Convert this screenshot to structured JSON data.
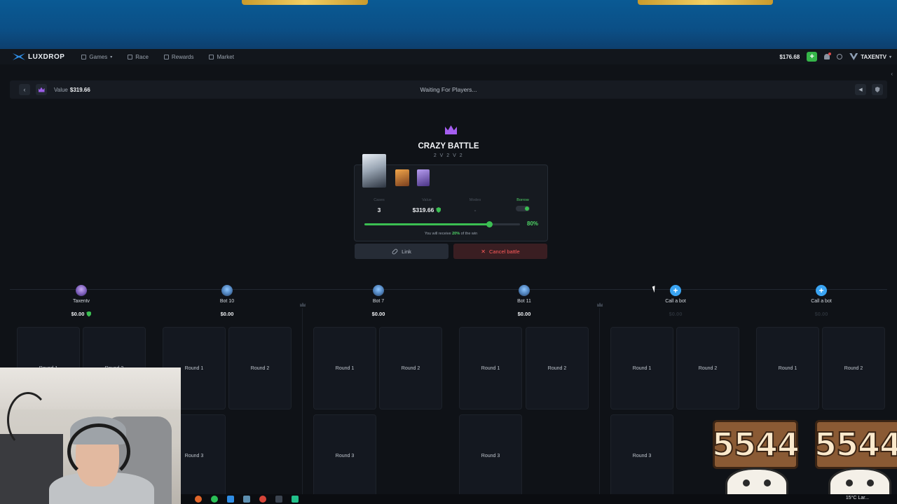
{
  "nav": {
    "brand": "LUXDROP",
    "items": [
      {
        "label": "Games",
        "icon": "gamepad-icon"
      },
      {
        "label": "Race",
        "icon": "flag-icon"
      },
      {
        "label": "Rewards",
        "icon": "gift-icon"
      },
      {
        "label": "Market",
        "icon": "cart-icon"
      }
    ],
    "balance": "$176.68",
    "add_funds": "+",
    "username": "TAXENTV"
  },
  "battle_bar": {
    "value_label": "Value",
    "value": "$319.66",
    "status": "Waiting For Players..."
  },
  "battle": {
    "title": "CRAZY BATTLE",
    "mode": "2 V 2 V 2",
    "stats": {
      "cases_label": "Cases",
      "cases": "3",
      "value_label": "Value",
      "value": "$319.66",
      "modes_label": "Modes",
      "modes": "-",
      "borrow_label": "Borrow"
    },
    "borrow_percent": 80,
    "borrow_percent_text": "80%",
    "receive_prefix": "You will receive",
    "receive_percent": "20%",
    "receive_suffix": "of the win",
    "link_label": "Link",
    "cancel_label": "Cancel battle"
  },
  "players": [
    {
      "name": "Taxentv",
      "value": "$0.00",
      "verified": true
    },
    {
      "name": "Bot 10",
      "value": "$0.00"
    },
    {
      "name": "Bot 7",
      "value": "$0.00"
    },
    {
      "name": "Bot 11",
      "value": "$0.00"
    },
    {
      "name": "Call a bot",
      "value": "$0.00"
    },
    {
      "name": "Call a bot",
      "value": "$0.00"
    }
  ],
  "rounds": {
    "r1": "Round 1",
    "r2": "Round 2",
    "r3": "Round 3"
  },
  "overlay": {
    "counter": "5544"
  },
  "taskbar": {
    "weather": "15°C Lar..."
  },
  "colors": {
    "accent_green": "#3bbf52",
    "accent_purple": "#a55ef0",
    "accent_blue": "#3aa4f2",
    "danger": "#ff5b5b"
  }
}
